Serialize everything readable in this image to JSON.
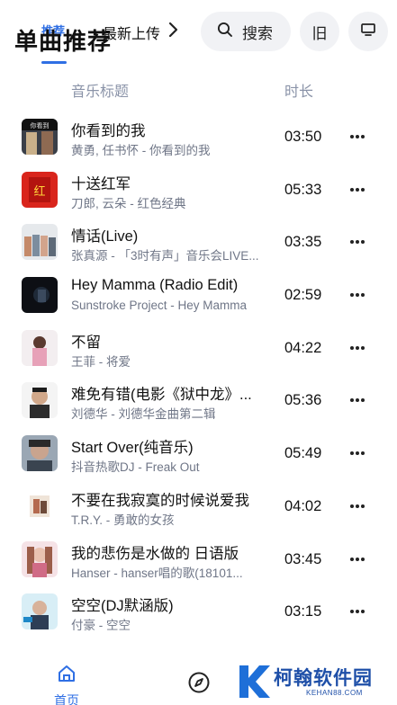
{
  "header": {
    "tab_small": "推荐",
    "tab_active": "单曲推荐",
    "tab_new": "最新上传",
    "search_label": "搜索",
    "old_label": "旧",
    "icons": [
      "chevron-right-icon",
      "search-icon",
      "monitor-icon"
    ]
  },
  "columns": {
    "title": "音乐标题",
    "duration": "时长"
  },
  "songs": [
    {
      "title": "你看到的我",
      "subtitle": "黄勇, 任书怀 - 你看到的我",
      "duration": "03:50"
    },
    {
      "title": "十送红军",
      "subtitle": "刀郎, 云朵 - 红色经典",
      "duration": "05:33"
    },
    {
      "title": "情话(Live)",
      "subtitle": "张真源 - 「3时有声」音乐会LIVE...",
      "duration": "03:35"
    },
    {
      "title": "Hey Mamma (Radio Edit)",
      "subtitle": "Sunstroke Project - Hey Mamma",
      "duration": "02:59"
    },
    {
      "title": "不留",
      "subtitle": "王菲 - 将爱",
      "duration": "04:22"
    },
    {
      "title": "难免有错(电影《狱中龙》...",
      "subtitle": "刘德华 - 刘德华金曲第二辑",
      "duration": "05:36"
    },
    {
      "title": "Start Over(纯音乐)",
      "subtitle": "抖音热歌DJ - Freak Out",
      "duration": "05:49"
    },
    {
      "title": "不要在我寂寞的时候说爱我",
      "subtitle": "T.R.Y. - 勇敢的女孩",
      "duration": "04:02"
    },
    {
      "title": "我的悲伤是水做的 日语版",
      "subtitle": "Hanser - hanser唱的歌(18101...",
      "duration": "03:45"
    },
    {
      "title": "空空(DJ默涵版)",
      "subtitle": "付豪 - 空空",
      "duration": "03:15"
    }
  ],
  "nav": {
    "home_label": "首页",
    "icons": [
      "home-icon",
      "compass-icon"
    ]
  },
  "watermark": {
    "name": "柯翰软件园",
    "url": "KEHAN88.COM"
  },
  "colors": {
    "accent": "#2f6fe4",
    "text": "#111111",
    "muted": "#6f7687",
    "header_muted": "#8a93a8",
    "pill_bg": "#f1f2f5"
  }
}
